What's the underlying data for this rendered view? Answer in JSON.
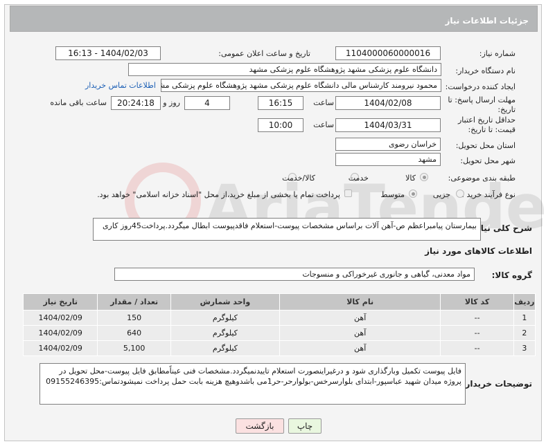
{
  "header": {
    "title": "جزئیات اطلاعات نیاز"
  },
  "labels": {
    "need_number": "شماره نیاز:",
    "announce_datetime": "تاریخ و ساعت اعلان عمومی:",
    "buyer_org": "نام دستگاه خریدار:",
    "creator": "ایجاد کننده درخواست:",
    "reply_deadline": "مهلت ارسال پاسخ: تا تاریخ:",
    "price_validity": "حداقل تاریخ اعتبار قیمت: تا تاریخ:",
    "time": "ساعت",
    "day_and": "روز و",
    "remaining": "ساعت باقی مانده",
    "province": "استان محل تحویل:",
    "city": "شهر محل تحویل:",
    "category": "طبقه بندی موضوعی:",
    "process": "نوع فرآیند خرید :",
    "general_desc": "شرح کلی نیاز:",
    "goods_info": "اطلاعات کالاهای مورد نیاز",
    "goods_group": "گروه کالا:",
    "buyer_notes": "توضیحات خریدار:"
  },
  "fields": {
    "need_number": "1104000060000016",
    "announce_datetime": "1404/02/03 - 16:13",
    "buyer_org": "دانشگاه علوم پزشکی مشهد   پژوهشگاه علوم پزشکی مشهد",
    "creator": "محمود نیرومند کارشناس مالی دانشگاه علوم پزشکی مشهد   پژوهشگاه علوم پزشکی مشهد",
    "contact_link": "اطلاعات تماس خریدار",
    "reply_date": "1404/02/08",
    "reply_time": "16:15",
    "days": "4",
    "remaining_time": "20:24:18",
    "validity_date": "1404/03/31",
    "validity_time": "10:00",
    "province": "خراسان رضوی",
    "city": "مشهد"
  },
  "category_options": [
    "کالا",
    "خدمت",
    "کالا/خدمت"
  ],
  "category_selected": "کالا",
  "process_options": [
    "جزیی",
    "متوسط"
  ],
  "process_selected": "متوسط",
  "payment_note": "پرداخت تمام یا بخشی از مبلغ خرید،از محل \"اسناد خزانه اسلامی\" خواهد بود.",
  "general_desc": "بیمارستان پیامبراعظم ص-آهن آلات براساس مشخصات پیوست-استعلام فاقدپیوست ابطال میگردد.پرداخت45روز کاری",
  "goods_group": "مواد معدنی، گیاهی و جانوری غیرخوراکی و منسوجات",
  "table": {
    "headers": [
      "ردیف",
      "کد کالا",
      "نام کالا",
      "واحد شمارش",
      "تعداد / مقدار",
      "تاریخ نیاز"
    ],
    "rows": [
      [
        "1",
        "--",
        "آهن",
        "کیلوگرم",
        "150",
        "1404/02/09"
      ],
      [
        "2",
        "--",
        "آهن",
        "کیلوگرم",
        "640",
        "1404/02/09"
      ],
      [
        "3",
        "--",
        "آهن",
        "کیلوگرم",
        "5,100",
        "1404/02/09"
      ]
    ]
  },
  "buyer_notes": "فایل پیوست تکمیل وبارگذاری شود و درغیراینصورت استعلام تاییدنمیگردد.مشخصات فنی عیناًمطابق فایل پیوست-محل تحویل در پروژه میدان شهید عباسپور-ابتدای بلوارسرخس-بولوارحر-حر1می باشدوهیچ هزینه بابت حمل  پرداخت نمیشودتماس:09155246395",
  "buttons": {
    "print": "چاپ",
    "back": "بازگشت"
  },
  "watermark": "AriaTender.net"
}
